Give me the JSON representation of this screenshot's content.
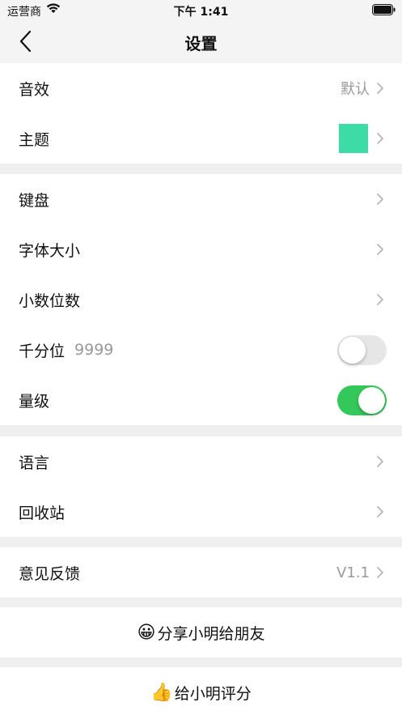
{
  "status_bar": {
    "carrier": "运营商",
    "time": "下午 1:41"
  },
  "nav": {
    "title": "设置"
  },
  "groups": [
    {
      "rows": [
        {
          "label": "音效",
          "value": "默认"
        },
        {
          "label": "主题",
          "swatch_color": "#3ddba5"
        }
      ]
    },
    {
      "rows": [
        {
          "label": "键盘"
        },
        {
          "label": "字体大小"
        },
        {
          "label": "小数位数"
        },
        {
          "label": "千分位",
          "sub": "9999",
          "toggle": false
        },
        {
          "label": "量级",
          "toggle": true
        }
      ]
    },
    {
      "rows": [
        {
          "label": "语言"
        },
        {
          "label": "回收站"
        }
      ]
    },
    {
      "rows": [
        {
          "label": "意见反馈",
          "value": "V1.1"
        }
      ]
    }
  ],
  "actions": {
    "share": {
      "emoji": "😀",
      "label": "分享小明给朋友"
    },
    "rate": {
      "emoji": "👍",
      "label": "给小明评分"
    }
  },
  "colors": {
    "toggle_on": "#34c759",
    "theme_swatch": "#3ddba5"
  }
}
